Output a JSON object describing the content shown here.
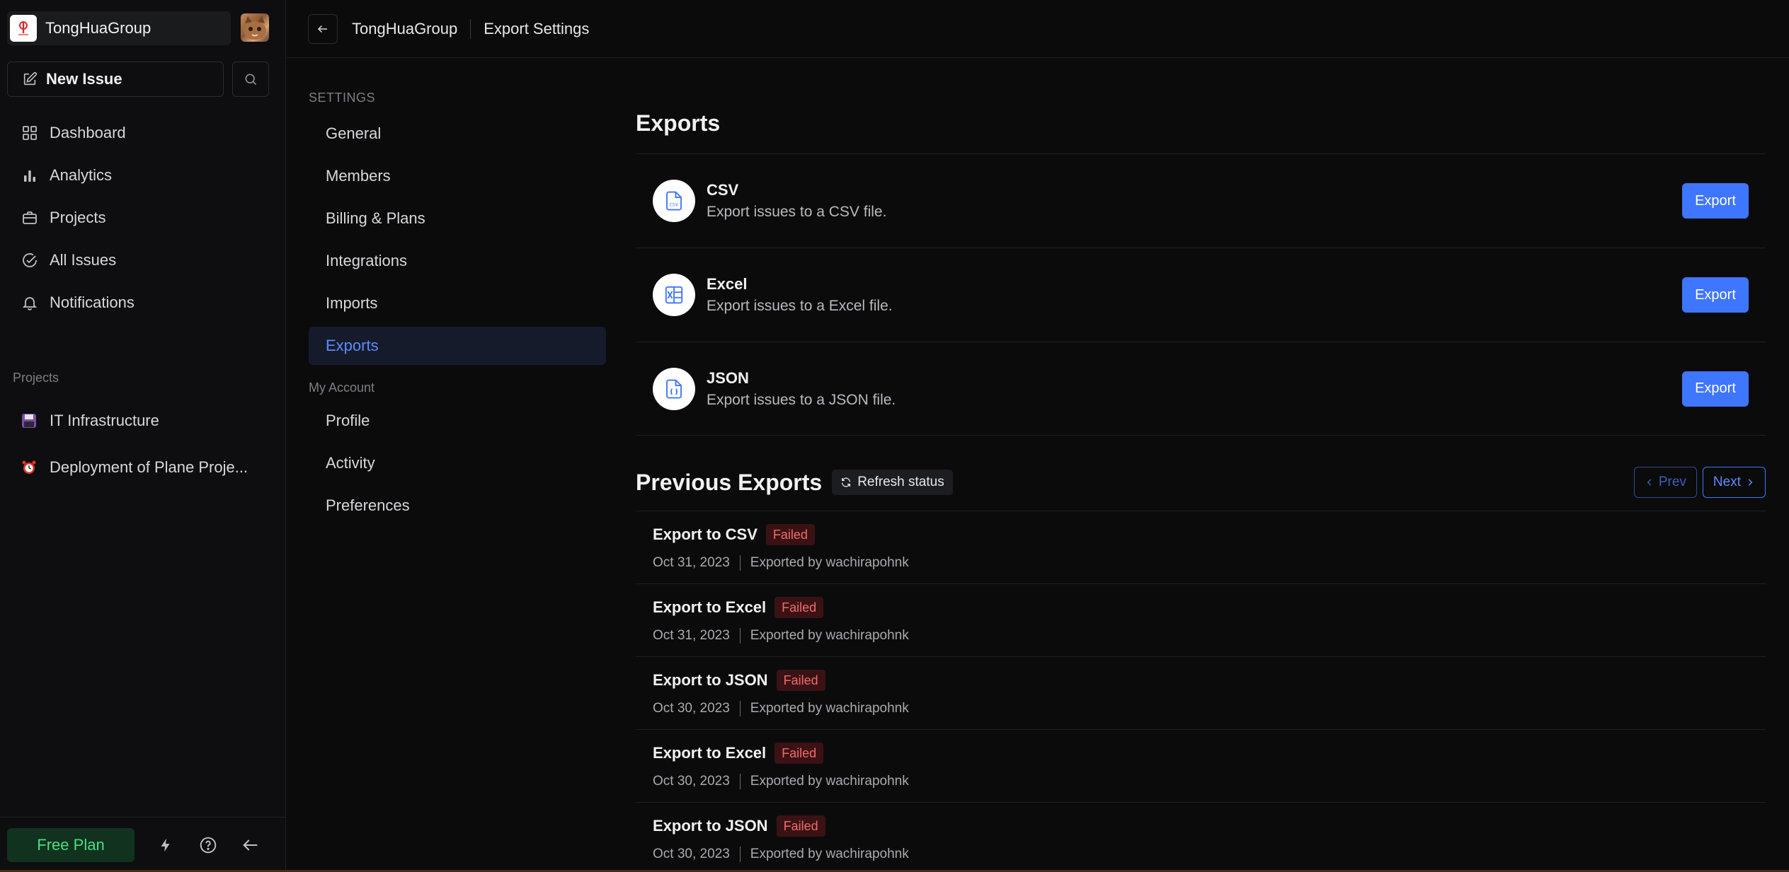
{
  "workspace": {
    "name": "TongHuaGroup"
  },
  "sidebar": {
    "new_issue_label": "New Issue",
    "nav": [
      {
        "label": "Dashboard",
        "icon": "grid-icon"
      },
      {
        "label": "Analytics",
        "icon": "bar-chart-icon"
      },
      {
        "label": "Projects",
        "icon": "briefcase-icon"
      },
      {
        "label": "All Issues",
        "icon": "check-circle-icon"
      },
      {
        "label": "Notifications",
        "icon": "bell-icon"
      }
    ],
    "projects_label": "Projects",
    "projects": [
      {
        "label": "IT Infrastructure",
        "icon": "floppy-disk-emoji"
      },
      {
        "label": "Deployment of Plane Proje...",
        "icon": "alarm-clock-emoji"
      }
    ],
    "footer": {
      "plan_label": "Free Plan"
    }
  },
  "header": {
    "workspace": "TongHuaGroup",
    "page": "Export Settings"
  },
  "settings_nav": {
    "settings_label": "SETTINGS",
    "items": [
      "General",
      "Members",
      "Billing & Plans",
      "Integrations",
      "Imports",
      "Exports"
    ],
    "active": "Exports",
    "account_label": "My Account",
    "account_items": [
      "Profile",
      "Activity",
      "Preferences"
    ]
  },
  "exports": {
    "title": "Exports",
    "formats": [
      {
        "name": "CSV",
        "description": "Export issues to a CSV file.",
        "button": "Export"
      },
      {
        "name": "Excel",
        "description": "Export issues to a Excel file.",
        "button": "Export"
      },
      {
        "name": "JSON",
        "description": "Export issues to a JSON file.",
        "button": "Export"
      }
    ]
  },
  "previous_exports": {
    "title": "Previous Exports",
    "refresh_label": "Refresh status",
    "prev_label": "Prev",
    "next_label": "Next",
    "items": [
      {
        "name": "Export to CSV",
        "status": "Failed",
        "date": "Oct 31, 2023",
        "by": "Exported by wachirapohnk"
      },
      {
        "name": "Export to Excel",
        "status": "Failed",
        "date": "Oct 31, 2023",
        "by": "Exported by wachirapohnk"
      },
      {
        "name": "Export to JSON",
        "status": "Failed",
        "date": "Oct 30, 2023",
        "by": "Exported by wachirapohnk"
      },
      {
        "name": "Export to Excel",
        "status": "Failed",
        "date": "Oct 30, 2023",
        "by": "Exported by wachirapohnk"
      },
      {
        "name": "Export to JSON",
        "status": "Failed",
        "date": "Oct 30, 2023",
        "by": "Exported by wachirapohnk"
      }
    ]
  },
  "colors": {
    "accent": "#3f76ff",
    "failed_text": "#f06b6b",
    "failed_bg": "#3b1214",
    "free_plan": "#4ade80"
  }
}
